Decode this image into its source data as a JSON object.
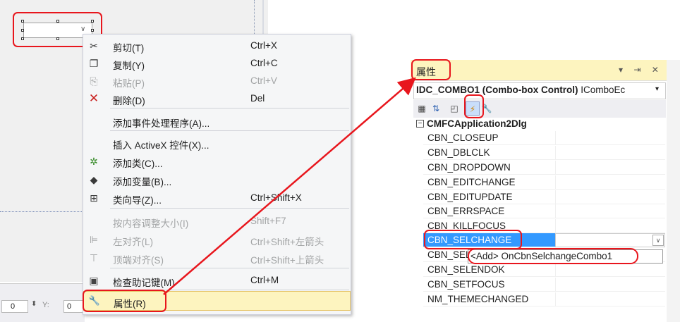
{
  "statusbar": {
    "x_value": "0",
    "y_label": "Y:",
    "y_value": "0"
  },
  "context_menu": {
    "items": [
      {
        "label": "剪切(T)",
        "shortcut": "Ctrl+X",
        "icon": "scissors-icon",
        "glyph": "✂",
        "disabled": false
      },
      {
        "label": "复制(Y)",
        "shortcut": "Ctrl+C",
        "icon": "copy-icon",
        "glyph": "❐",
        "disabled": false
      },
      {
        "label": "粘贴(P)",
        "shortcut": "Ctrl+V",
        "icon": "paste-icon",
        "glyph": "⎘",
        "disabled": true
      },
      {
        "label": "删除(D)",
        "shortcut": "Del",
        "icon": "delete-icon",
        "glyph": "✕",
        "disabled": false
      },
      {
        "label": "添加事件处理程序(A)...",
        "shortcut": "",
        "icon": "",
        "glyph": "",
        "disabled": false
      },
      {
        "label": "插入 ActiveX 控件(X)...",
        "shortcut": "",
        "icon": "",
        "glyph": "",
        "disabled": false
      },
      {
        "label": "添加类(C)...",
        "shortcut": "",
        "icon": "add-class-icon",
        "glyph": "✲",
        "disabled": false
      },
      {
        "label": "添加变量(B)...",
        "shortcut": "",
        "icon": "add-variable-icon",
        "glyph": "◆",
        "disabled": false
      },
      {
        "label": "类向导(Z)...",
        "shortcut": "Ctrl+Shift+X",
        "icon": "class-wizard-icon",
        "glyph": "⊞",
        "disabled": false
      },
      {
        "label": "按内容调整大小(I)",
        "shortcut": "Shift+F7",
        "icon": "",
        "glyph": "",
        "disabled": true
      },
      {
        "label": "左对齐(L)",
        "shortcut": "Ctrl+Shift+左箭头",
        "icon": "align-left-icon",
        "glyph": "⊫",
        "disabled": true
      },
      {
        "label": "顶端对齐(S)",
        "shortcut": "Ctrl+Shift+上箭头",
        "icon": "align-top-icon",
        "glyph": "⊤",
        "disabled": true
      },
      {
        "label": "检查助记键(M)",
        "shortcut": "Ctrl+M",
        "icon": "mnemonics-icon",
        "glyph": "▣",
        "disabled": false
      },
      {
        "label": "属性(R)",
        "shortcut": "",
        "icon": "wrench-icon",
        "glyph": "🔧",
        "disabled": false
      }
    ]
  },
  "properties": {
    "title": "属性",
    "title_controls": "▾ ⇥ ✕",
    "object_name": "IDC_COMBO1 (Combo-box Control)",
    "object_interface": " IComboEc",
    "category": "CMFCApplication2Dlg",
    "events": [
      "CBN_CLOSEUP",
      "CBN_DBLCLK",
      "CBN_DROPDOWN",
      "CBN_EDITCHANGE",
      "CBN_EDITUPDATE",
      "CBN_ERRSPACE",
      "CBN_KILLFOCUS",
      "CBN_SELCHANGE",
      "CBN_SELENDCANCEL",
      "CBN_SELENDOK",
      "CBN_SETFOCUS",
      "NM_THEMECHANGED"
    ],
    "selected_event": "CBN_SELCHANGE",
    "partial_event_label": "CBN_SEL",
    "dropdown_option": "<Add> OnCbnSelchangeCombo1"
  },
  "colors": {
    "annotation": "#e8161d",
    "selection": "#3399ff",
    "highlight": "#fdf4bf"
  }
}
